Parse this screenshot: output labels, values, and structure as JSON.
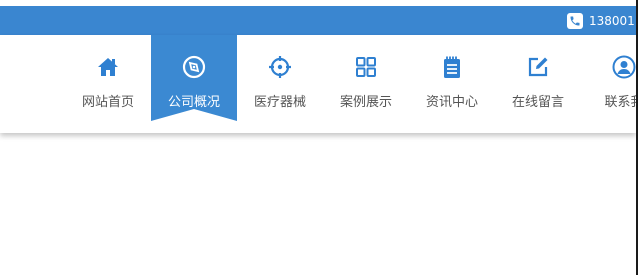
{
  "header": {
    "phone_text": "138001"
  },
  "nav": {
    "items": [
      {
        "label": "网站首页",
        "icon": "home-icon"
      },
      {
        "label": "公司概况",
        "icon": "compass-icon",
        "active": true
      },
      {
        "label": "医疗器械",
        "icon": "crosshair-icon"
      },
      {
        "label": "案例展示",
        "icon": "grid-icon"
      },
      {
        "label": "资讯中心",
        "icon": "notepad-icon"
      },
      {
        "label": "在线留言",
        "icon": "edit-icon"
      },
      {
        "label": "联系我",
        "icon": "user-icon"
      }
    ]
  },
  "colors": {
    "topbar": "#3a86d0",
    "nav_icon": "#2f80d1",
    "nav_text": "#555555",
    "active_bg": "#3b89d2"
  }
}
